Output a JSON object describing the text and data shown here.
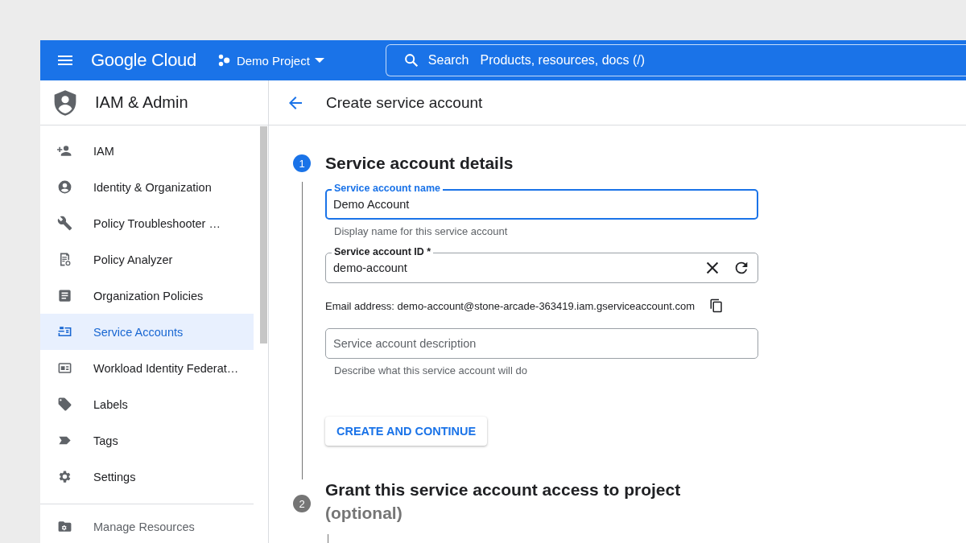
{
  "header": {
    "logo": "Google Cloud",
    "project": "Demo Project",
    "search": {
      "label": "Search",
      "placeholder": "Products, resources, docs (/)"
    }
  },
  "sidebar": {
    "title": "IAM & Admin",
    "items": [
      {
        "label": "IAM",
        "selected": false
      },
      {
        "label": "Identity & Organization",
        "selected": false
      },
      {
        "label": "Policy Troubleshooter …",
        "selected": false
      },
      {
        "label": "Policy Analyzer",
        "selected": false
      },
      {
        "label": "Organization Policies",
        "selected": false
      },
      {
        "label": "Service Accounts",
        "selected": true
      },
      {
        "label": "Workload Identity Federat…",
        "selected": false
      },
      {
        "label": "Labels",
        "selected": false
      },
      {
        "label": "Tags",
        "selected": false
      },
      {
        "label": "Settings",
        "selected": false
      }
    ],
    "footer_items": [
      {
        "label": "Manage Resources",
        "selected": false
      }
    ]
  },
  "page": {
    "title": "Create service account"
  },
  "steps": [
    {
      "number": "1",
      "title": "Service account details",
      "active": true,
      "fields": [
        {
          "kind": "plain",
          "label": "Service account name",
          "value": "Demo Account",
          "helper": "Display name for this service account",
          "focused": true
        },
        {
          "kind": "resettable",
          "label": "Service account ID *",
          "value": "demo-account",
          "focused": false,
          "note": "Email address: demo-account@stone-arcade-363419.iam.gserviceaccount.com"
        },
        {
          "kind": "plain",
          "placeholder": "Service account description",
          "helper": "Describe what this service account will do",
          "focused": false
        }
      ],
      "button": "CREATE AND CONTINUE"
    },
    {
      "number": "2",
      "title": "Grant this service account access to project",
      "subtitle": "(optional)",
      "active": false
    }
  ]
}
